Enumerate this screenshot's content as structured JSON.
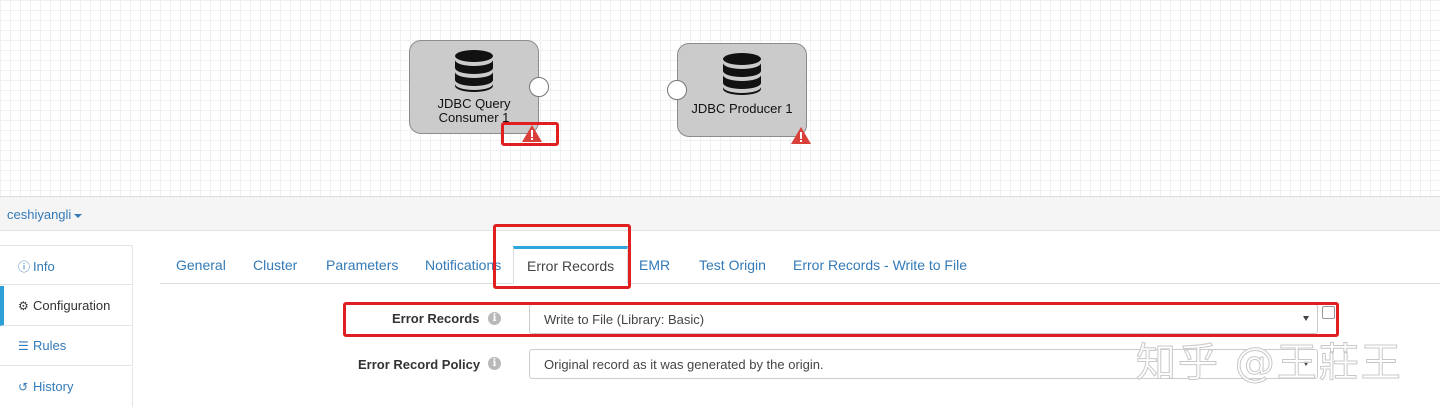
{
  "canvas": {
    "stages": [
      {
        "name": "JDBC Query Consumer 1",
        "line1": "JDBC Query",
        "line2": "Consumer 1",
        "icon": "database-icon",
        "status_icon": "warning-icon"
      },
      {
        "name": "JDBC Producer 1",
        "line1": "JDBC Producer 1",
        "icon": "database-icon",
        "status_icon": "warning-icon"
      }
    ]
  },
  "pipeline": {
    "name": "ceshiyangli"
  },
  "sidebar": {
    "items": [
      {
        "label": "Info",
        "icon": "info-icon"
      },
      {
        "label": "Configuration",
        "icon": "gear-icon"
      },
      {
        "label": "Rules",
        "icon": "list-icon"
      },
      {
        "label": "History",
        "icon": "history-icon"
      }
    ]
  },
  "tabs": [
    "General",
    "Cluster",
    "Parameters",
    "Notifications",
    "Error Records",
    "EMR",
    "Test Origin",
    "Error Records - Write to File"
  ],
  "active_tab": "Error Records",
  "form": {
    "error_records": {
      "label": "Error Records",
      "value": "Write to File (Library: Basic)"
    },
    "error_record_policy": {
      "label": "Error Record Policy",
      "value": "Original record as it was generated by the origin."
    }
  },
  "watermark": "知乎 @王莊王",
  "colors": {
    "link": "#337ab7",
    "accent": "#2ea5dd",
    "highlight": "#e02020",
    "warning": "#d9403a"
  }
}
